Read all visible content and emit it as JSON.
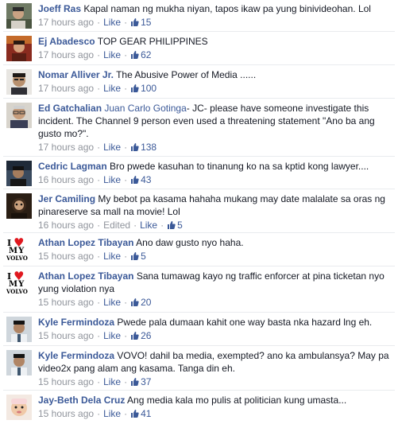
{
  "comments": [
    {
      "author": "Joeff Ras",
      "text": "Kapal naman ng mukha niyan, tapos ikaw pa yung binivideohan. Lol",
      "time": "17 hours ago",
      "like_label": "Like",
      "likes": "15",
      "avatar": "photo-avatar"
    },
    {
      "author": "Ej Abadesco",
      "text": "TOP GEAR PHILIPPINES",
      "time": "17 hours ago",
      "like_label": "Like",
      "likes": "62",
      "avatar": "photo-avatar"
    },
    {
      "author": "Nomar Alliver Jr.",
      "text": "The Abusive Power of Media ......",
      "time": "17 hours ago",
      "like_label": "Like",
      "likes": "100",
      "avatar": "photo-avatar"
    },
    {
      "author": "Ed Gatchalian",
      "mention": "Juan Carlo Gotinga",
      "text": "- JC- please have someone investigate this incident. The Channel 9 person even used a threatening statement \"Ano ba ang gusto mo?\".",
      "time": "17 hours ago",
      "like_label": "Like",
      "likes": "138",
      "avatar": "photo-avatar"
    },
    {
      "author": "Cedric Lagman",
      "text": "Bro pwede kasuhan to tinanung ko na sa kptid kong lawyer....",
      "time": "16 hours ago",
      "like_label": "Like",
      "likes": "43",
      "avatar": "photo-avatar"
    },
    {
      "author": "Jer Camiling",
      "text": "My bebot pa kasama hahaha mukang may date malalate sa oras ng pinareserve sa mall na movie! Lol",
      "time": "16 hours ago",
      "edited_label": "Edited",
      "like_label": "Like",
      "likes": "5",
      "avatar": "photo-avatar"
    },
    {
      "author": "Athan Lopez Tibayan",
      "text": "Ano daw gusto nyo haha.",
      "time": "15 hours ago",
      "like_label": "Like",
      "likes": "5",
      "avatar": "i-love-my-volvo-logo",
      "logo_text": {
        "i": "I",
        "heart": "♥",
        "my": "MY",
        "brand": "VOLVO"
      }
    },
    {
      "author": "Athan Lopez Tibayan",
      "text": "Sana tumawag kayo ng traffic enforcer at pina ticketan nyo yung violation nya",
      "time": "15 hours ago",
      "like_label": "Like",
      "likes": "20",
      "avatar": "i-love-my-volvo-logo",
      "logo_text": {
        "i": "I",
        "heart": "♥",
        "my": "MY",
        "brand": "VOLVO"
      }
    },
    {
      "author": "Kyle Fermindoza",
      "text": "Pwede pala dumaan kahit one way basta nka hazard lng eh.",
      "time": "15 hours ago",
      "like_label": "Like",
      "likes": "26",
      "avatar": "photo-avatar"
    },
    {
      "author": "Kyle Fermindoza",
      "text": "VOVO! dahil ba media, exempted? ano ka ambulansya? May pa video2x pang alam ang kasama. Tanga din eh.",
      "time": "15 hours ago",
      "like_label": "Like",
      "likes": "37",
      "avatar": "photo-avatar"
    },
    {
      "author": "Jay-Beth Dela Cruz",
      "text": "Ang media kala mo pulis at politician kung umasta...",
      "time": "15 hours ago",
      "like_label": "Like",
      "likes": "41",
      "avatar": "photo-avatar"
    }
  ],
  "separator": "·",
  "colors": {
    "author_link": "#3b5998",
    "meta_text": "#90949c",
    "body_text": "#141823",
    "divider": "#e9ebee"
  }
}
